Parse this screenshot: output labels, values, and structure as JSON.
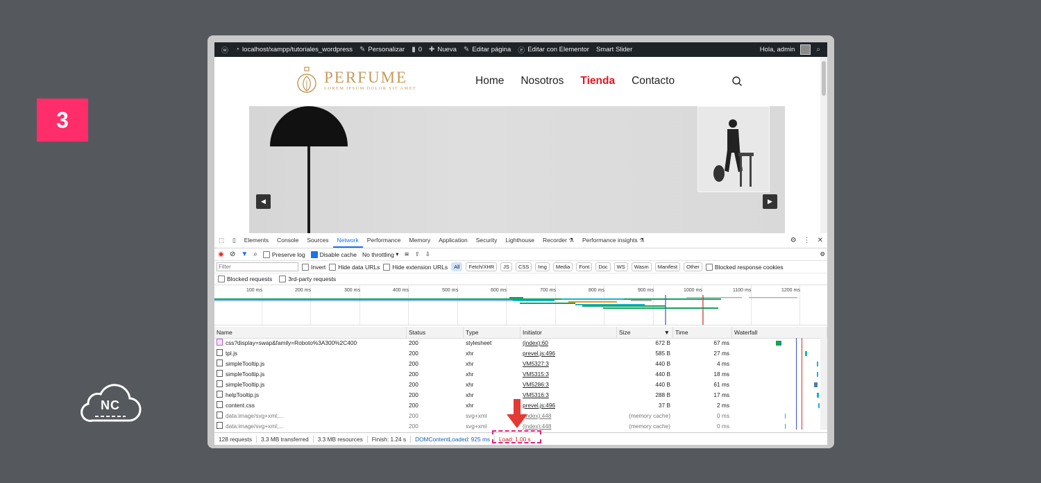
{
  "step": {
    "number": "3"
  },
  "brand": {
    "logo_text": "NC"
  },
  "admin_bar": {
    "site": "localhost/xampp/tutoriales_wordpress",
    "customize": "Personalizar",
    "comments_count": "0",
    "new": "Nueva",
    "edit_page": "Editar página",
    "edit_elementor": "Editar con Elementor",
    "smart_slider": "Smart Slider",
    "greeting": "Hola, admin"
  },
  "site": {
    "logo_name": "PERFUME",
    "logo_tagline": "LOREM IPSUM DOLOR SIT AMET",
    "nav": [
      "Home",
      "Nosotros",
      "Tienda",
      "Contacto"
    ],
    "active_nav": "Tienda"
  },
  "devtools": {
    "tabs": [
      "Elements",
      "Console",
      "Sources",
      "Network",
      "Performance",
      "Memory",
      "Application",
      "Security",
      "Lighthouse",
      "Recorder ⚗",
      "Performance insights ⚗"
    ],
    "active_tab": "Network",
    "toolbar": {
      "preserve_log": "Preserve log",
      "disable_cache": "Disable cache",
      "throttling": "No throttling"
    },
    "filter": {
      "placeholder": "Filter",
      "invert": "Invert",
      "hide_data_urls": "Hide data URLs",
      "hide_extension_urls": "Hide extension URLs",
      "types": [
        "All",
        "Fetch/XHR",
        "JS",
        "CSS",
        "Img",
        "Media",
        "Font",
        "Doc",
        "WS",
        "Wasm",
        "Manifest",
        "Other"
      ],
      "blocked_response_cookies": "Blocked response cookies",
      "blocked_requests": "Blocked requests",
      "third_party": "3rd-party requests"
    },
    "timeline_ticks": [
      "100 ms",
      "200 ms",
      "300 ms",
      "400 ms",
      "500 ms",
      "600 ms",
      "700 ms",
      "800 ms",
      "900 ms",
      "1000 ms",
      "1100 ms",
      "1200 ms"
    ],
    "columns": [
      "Name",
      "Status",
      "Type",
      "Initiator",
      "Size",
      "Time",
      "Waterfall"
    ],
    "rows": [
      {
        "name": "css?display=swap&family=Roboto%3A300%2C400",
        "status": "200",
        "type": "stylesheet",
        "initiator": "(index):60",
        "size": "672 B",
        "time": "67 ms",
        "icon": "css"
      },
      {
        "name": "tpl.js",
        "status": "200",
        "type": "xhr",
        "initiator": "prevel.js:496",
        "size": "585 B",
        "time": "27 ms",
        "icon": "doc"
      },
      {
        "name": "simpleTooltip.js",
        "status": "200",
        "type": "xhr",
        "initiator": "VM5327:3",
        "size": "440 B",
        "time": "4 ms",
        "icon": "doc"
      },
      {
        "name": "simpleTooltip.js",
        "status": "200",
        "type": "xhr",
        "initiator": "VM5315:3",
        "size": "440 B",
        "time": "18 ms",
        "icon": "doc"
      },
      {
        "name": "simpleTooltip.js",
        "status": "200",
        "type": "xhr",
        "initiator": "VM5286:3",
        "size": "440 B",
        "time": "61 ms",
        "icon": "doc"
      },
      {
        "name": "helpTooltip.js",
        "status": "200",
        "type": "xhr",
        "initiator": "VM5316:3",
        "size": "288 B",
        "time": "17 ms",
        "icon": "doc"
      },
      {
        "name": "content.css",
        "status": "200",
        "type": "xhr",
        "initiator": "prevel.js:496",
        "size": "37 B",
        "time": "2 ms",
        "icon": "doc"
      },
      {
        "name": "data:image/svg+xml;...",
        "status": "200",
        "type": "svg+xml",
        "initiator": "(index):448",
        "size": "(memory cache)",
        "time": "0 ms",
        "icon": "img"
      },
      {
        "name": "data:image/svg+xml;...",
        "status": "200",
        "type": "svg+xml",
        "initiator": "(index):448",
        "size": "(memory cache)",
        "time": "0 ms",
        "icon": "img"
      }
    ],
    "status_bar": {
      "requests": "128 requests",
      "transferred": "3.3 MB transferred",
      "resources": "3.3 MB resources",
      "finish": "Finish: 1.24 s",
      "dom_content_loaded": "DOMContentLoaded: 925 ms",
      "load": "Load: 1.00 s"
    }
  },
  "colors": {
    "badge": "#ff2d6a",
    "accent_blue": "#1a73e8",
    "nav_active": "#e5151f",
    "logo_gold": "#c59a5b",
    "highlight": "#e0207a"
  }
}
